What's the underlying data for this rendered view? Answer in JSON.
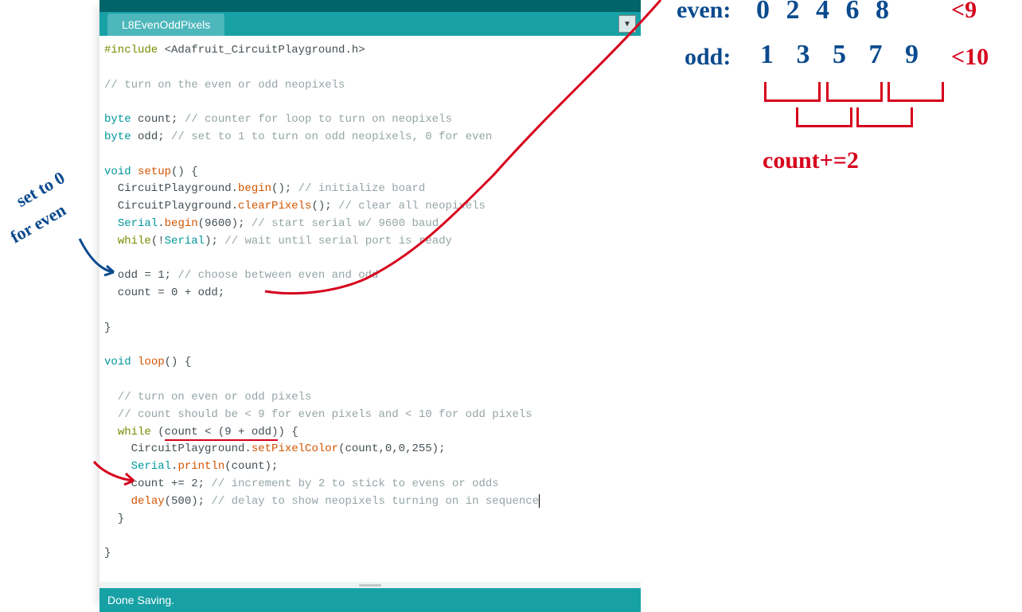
{
  "ide": {
    "tab_label": "L8EvenOddPixels",
    "status": "Done Saving."
  },
  "code": {
    "l1_include": "#include",
    "l1_lib": "<Adafruit_CircuitPlayground.h>",
    "c1": "// turn on the even or odd neopixels",
    "t_byte": "byte",
    "v_count_decl": " count; ",
    "c_count": "// counter for loop to turn on neopixels",
    "v_odd_decl": " odd; ",
    "c_odd": "// set to 1 to turn on odd neopixels, 0 for even",
    "t_void": "void",
    "f_setup": "setup",
    "paren_brace": "() {",
    "cp_begin_pre": "  CircuitPlayground.",
    "f_begin": "begin",
    "cp_begin_post": "(); ",
    "c_init": "// initialize board",
    "cp_clear_pre": "  CircuitPlayground.",
    "f_clear": "clearPixels",
    "cp_clear_post": "(); ",
    "c_clear": "// clear all neopixels",
    "serial_pre": "  ",
    "cls_serial": "Serial",
    "serial_begin_mid": ".",
    "f_sbegin": "begin",
    "serial_begin_args": "(9600); ",
    "c_serial": "// start serial w/ 9600 baud",
    "while_pre": "  ",
    "kw_while": "while",
    "while_args": "(!",
    "while_serial_post": "); ",
    "c_wait": "// wait until serial port is ready",
    "odd_assign": "  odd = 1; ",
    "c_choose": "// choose between even and odd",
    "count_assign": "  count = 0 + odd;",
    "brace_close": "}",
    "f_loop": "loop",
    "c_turnon": "  // turn on even or odd pixels",
    "c_cond": "  // count should be < 9 for even pixels and < 10 for odd pixels",
    "while_loop_pre": "  ",
    "while_loop_open": " (",
    "while_cond": "count < (9 + odd)",
    "while_loop_close": ") {",
    "setpix_pre": "    CircuitPlayground.",
    "f_setpix": "setPixelColor",
    "setpix_args": "(count,0,0,255);",
    "println_pre": "    ",
    "println_mid": ".",
    "f_println": "println",
    "println_args": "(count);",
    "count_inc": "    count += 2; ",
    "c_inc": "// increment by 2 to stick to evens or odds",
    "delay_pre": "    ",
    "f_delay": "delay",
    "delay_args": "(500); ",
    "c_delay": "// delay to show neopixels turning on in sequence",
    "inner_close": "  }"
  },
  "annotations": {
    "setto0": "set to 0",
    "foreven": "for even",
    "even_label": "even:",
    "even_nums": "0 2 4 6 8",
    "even_limit": "<9",
    "odd_label": "odd:",
    "odd_nums": "1 3 5 7 9",
    "odd_limit": "<10",
    "count_plus": "count+=2"
  }
}
